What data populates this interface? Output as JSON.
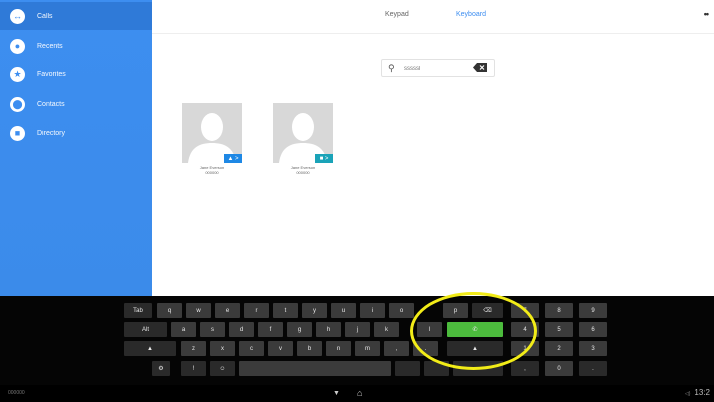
{
  "sidebar": {
    "items": [
      {
        "label": "Calls",
        "icon": "phone-icon",
        "glyph": "↔"
      },
      {
        "label": "Recents",
        "icon": "clock-icon",
        "glyph": "●"
      },
      {
        "label": "Favorites",
        "icon": "star-icon",
        "glyph": "★"
      },
      {
        "label": "Contacts",
        "icon": "person-icon",
        "glyph": "⬤"
      },
      {
        "label": "Directory",
        "icon": "directory-icon",
        "glyph": "■"
      }
    ]
  },
  "topbar": {
    "tabs": [
      "Keypad",
      "Keyboard"
    ],
    "active_tab": "Keyboard",
    "overflow": "••"
  },
  "search": {
    "value": "sssssl",
    "icon": "search-icon"
  },
  "contacts": [
    {
      "name": "Jane Everson",
      "number": "000000",
      "badge": "▲ >",
      "badge_color": "#1e88e5"
    },
    {
      "name": "Jane Everson",
      "number": "000000",
      "badge": "■ >",
      "badge_color": "#1aa3b8"
    }
  ],
  "keyboard": {
    "row1": [
      "Tab",
      "q",
      "w",
      "e",
      "r",
      "t",
      "y",
      "u",
      "i",
      "o",
      "p"
    ],
    "row2": [
      "Alt",
      "a",
      "s",
      "d",
      "f",
      "g",
      "h",
      "j",
      "k",
      "l"
    ],
    "row3": [
      "▲",
      "z",
      "x",
      "c",
      "v",
      "b",
      "n",
      "m",
      ",",
      "."
    ],
    "row4_left": [
      "⚙",
      "!",
      "☺"
    ],
    "numpad": [
      "7",
      "8",
      "9",
      "4",
      "5",
      "6",
      "1",
      "2",
      "3",
      ",",
      "0",
      "."
    ],
    "call_glyph": "✆",
    "backspace_glyph": "⌫",
    "shift_glyph": "▲"
  },
  "navbar": {
    "left": "000000",
    "back": "▼",
    "home": "⌂",
    "status": "13:2",
    "volume": "◁)"
  },
  "colors": {
    "sidebar": "#3d8ef0",
    "accent": "#3d8ef0",
    "call_green": "#4cbb3d",
    "highlight": "#f2ec18"
  }
}
